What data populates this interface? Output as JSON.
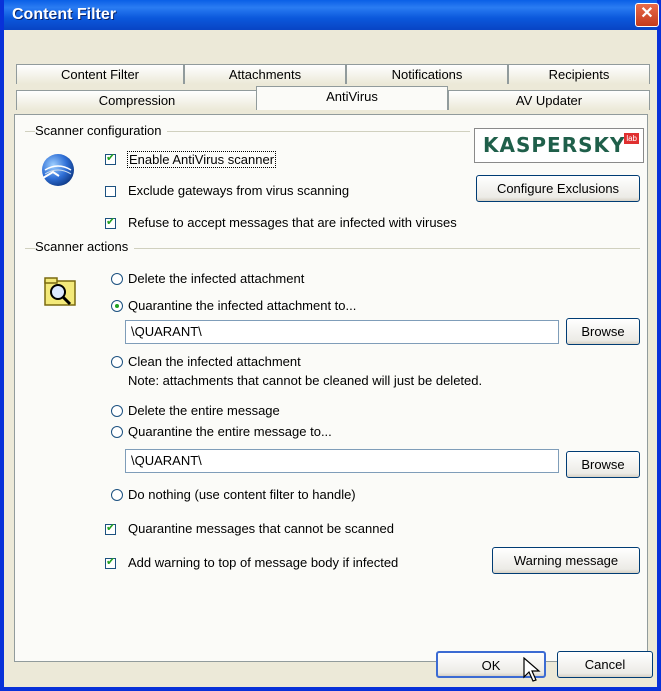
{
  "window": {
    "title": "Content Filter",
    "close_glyph": "✕"
  },
  "tabs_row1": [
    "Content Filter",
    "Attachments",
    "Notifications",
    "Recipients"
  ],
  "tabs_row2": [
    "Compression",
    "AntiVirus",
    "AV Updater"
  ],
  "scanner_config": {
    "label": "Scanner configuration",
    "logo_text": "KASPERSKY",
    "logo_sub": "lab",
    "enable_scanner": {
      "label": "Enable AntiVirus scanner",
      "checked": true
    },
    "exclude_gateways": {
      "label": "Exclude gateways from virus scanning",
      "checked": false
    },
    "refuse_infected": {
      "label": "Refuse to accept messages that are infected with viruses",
      "checked": true
    },
    "configure_exclusions": "Configure Exclusions"
  },
  "scanner_actions": {
    "label": "Scanner actions",
    "delete_attachment": "Delete the infected attachment",
    "quarantine_attachment": "Quarantine the infected attachment to...",
    "quarantine_attachment_path": "\\QUARANT\\",
    "browse1": "Browse",
    "clean_attachment": "Clean the infected attachment",
    "clean_note": "Note: attachments that cannot be cleaned will just be deleted.",
    "delete_message": "Delete the entire message",
    "quarantine_message": "Quarantine the entire message to...",
    "quarantine_message_path": "\\QUARANT\\",
    "browse2": "Browse",
    "do_nothing": "Do nothing (use content filter to handle)",
    "quarantine_unscanned": {
      "label": "Quarantine messages that cannot be scanned",
      "checked": true
    },
    "add_warning": {
      "label": "Add warning to top of message body if infected",
      "checked": true
    },
    "warning_message_button": "Warning message"
  },
  "footer": {
    "ok": "OK",
    "cancel": "Cancel"
  }
}
